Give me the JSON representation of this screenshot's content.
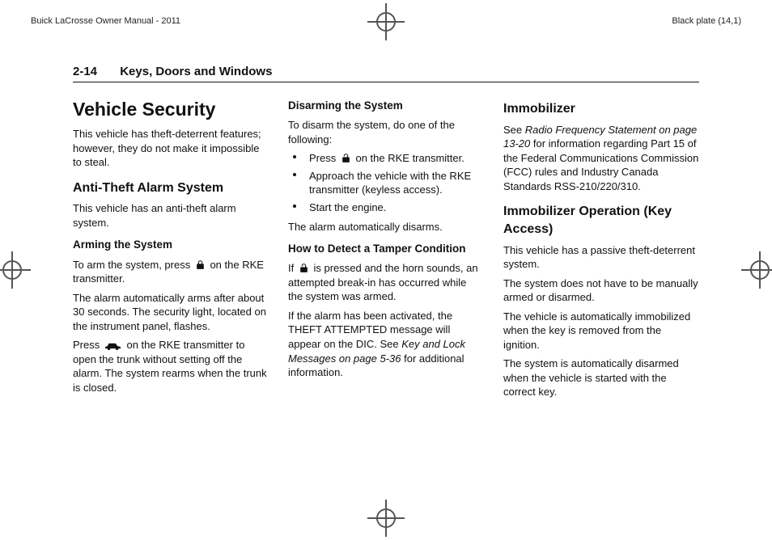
{
  "header": {
    "manual_title": "Buick LaCrosse Owner Manual - 2011",
    "plate_label": "Black plate (14,1)"
  },
  "page": {
    "number": "2-14",
    "section": "Keys, Doors and Windows"
  },
  "col1": {
    "h1": "Vehicle Security",
    "p1": "This vehicle has theft-deterrent features; however, they do not make it impossible to steal.",
    "h2": "Anti-Theft Alarm System",
    "p2": "This vehicle has an anti-theft alarm system.",
    "h3": "Arming the System",
    "p3a": "To arm the system, press ",
    "p3b": " on the RKE transmitter.",
    "p4": "The alarm automatically arms after about 30 seconds. The security light, located on the instrument panel, flashes.",
    "p5a": "Press ",
    "p5b": " on the RKE transmitter to open the trunk without setting off the alarm. The system rearms when the trunk is closed."
  },
  "col2": {
    "h3a": "Disarming the System",
    "p1": "To disarm the system, do one of the following:",
    "li1a": "Press ",
    "li1b": " on the RKE transmitter.",
    "li2": "Approach the vehicle with the RKE transmitter (keyless access).",
    "li3": "Start the engine.",
    "p2": "The alarm automatically disarms.",
    "h3b": "How to Detect a Tamper Condition",
    "p3a": "If ",
    "p3b": " is pressed and the horn sounds, an attempted break-in has occurred while the system was armed.",
    "p4a": "If the alarm has been activated, the THEFT ATTEMPTED message will appear on the DIC. See ",
    "p4i": "Key and Lock Messages on page 5-36",
    "p4b": " for additional information."
  },
  "col3": {
    "h2a": "Immobilizer",
    "p1a": "See ",
    "p1i": "Radio Frequency Statement on page 13-20",
    "p1b": " for information regarding Part 15 of the Federal Communications Commission (FCC) rules and Industry Canada Standards RSS-210/220/310.",
    "h2b": "Immobilizer Operation (Key Access)",
    "p2": "This vehicle has a passive theft-deterrent system.",
    "p3": "The system does not have to be manually armed or disarmed.",
    "p4": "The vehicle is automatically immobilized when the key is removed from the ignition.",
    "p5": "The system is automatically disarmed when the vehicle is started with the correct key."
  }
}
